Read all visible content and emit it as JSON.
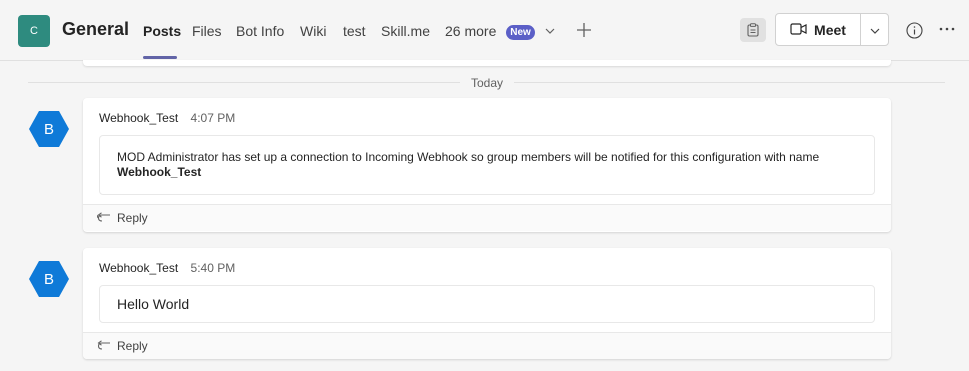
{
  "header": {
    "team_initial": "C",
    "channel_name": "General",
    "tabs": [
      {
        "label": "Posts"
      },
      {
        "label": "Files"
      },
      {
        "label": "Bot Info"
      },
      {
        "label": "Wiki"
      },
      {
        "label": "test"
      },
      {
        "label": "Skill.me"
      },
      {
        "label": "26 more"
      }
    ],
    "new_badge": "New",
    "meet_label": "Meet"
  },
  "feed": {
    "date_divider": "Today",
    "messages": [
      {
        "author": "Webhook_Test",
        "time": "4:07 PM",
        "avatar_initial": "B",
        "text": "MOD Administrator has set up a connection to Incoming Webhook so group members will be notified for this configuration with name",
        "text_bold": "Webhook_Test",
        "reply_label": "Reply"
      },
      {
        "author": "Webhook_Test",
        "time": "5:40 PM",
        "avatar_initial": "B",
        "text": "Hello World",
        "reply_label": "Reply"
      }
    ]
  },
  "colors": {
    "accent": "#6264a7",
    "badge": "#5b5fc7",
    "team_avatar": "#2e8b7f",
    "bot_avatar": "#0f7ad8"
  },
  "icons": {
    "chevron": "chevron-down-icon",
    "add": "plus-icon",
    "clipboard": "clipboard-icon",
    "video": "video-camera-icon",
    "info": "info-icon",
    "more": "more-options-icon",
    "reply": "reply-arrow-icon"
  }
}
